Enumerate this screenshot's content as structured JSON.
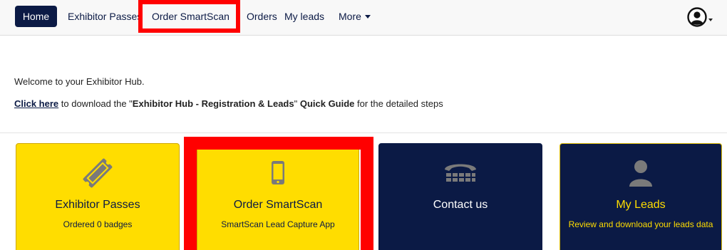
{
  "nav": {
    "home": "Home",
    "exhibitor_passes": "Exhibitor Passes",
    "order_smartscan": "Order SmartScan",
    "orders": "Orders",
    "my_leads": "My leads",
    "more": "More"
  },
  "user_menu": {
    "icon": "user-circle-icon"
  },
  "intro": {
    "welcome": "Welcome to your Exhibitor Hub.",
    "link": "Click here",
    "text_before": " to download the \"",
    "guide_name": "Exhibitor Hub - Registration & Leads",
    "text_after_name": "\" ",
    "quick_guide": "Quick Guide",
    "text_end": " for the detailed steps"
  },
  "cards": [
    {
      "title": "Exhibitor Passes",
      "subtitle": "Ordered 0 badges",
      "icon": "ticket-icon"
    },
    {
      "title": "Order SmartScan",
      "subtitle": "SmartScan Lead Capture App",
      "icon": "mobile-phone-icon"
    },
    {
      "title": "Contact us",
      "subtitle": "",
      "icon": "telephone-icon"
    },
    {
      "title": "My Leads",
      "subtitle": "Review and download your leads data",
      "icon": "person-icon"
    }
  ],
  "colors": {
    "navy": "#0b1a45",
    "yellow": "#ffdd00",
    "highlight": "#ff0000",
    "icon_grey": "#7a7a7a"
  }
}
